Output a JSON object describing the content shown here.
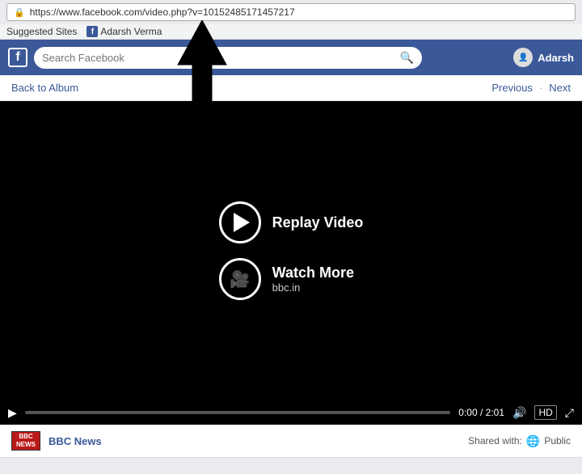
{
  "browser": {
    "url": "https://www.facebook.com/video.php?v=10152485171457217",
    "https_label": "https://www.facebook.com/video.php?v=10152485171457217",
    "bookmarks": [
      {
        "label": "Suggested Sites"
      },
      {
        "label": "Adarsh Verma",
        "has_fb_icon": true
      }
    ]
  },
  "navbar": {
    "logo_letter": "f",
    "search_placeholder": "Search Facebook",
    "user_name": "Adarsh"
  },
  "page_nav": {
    "back_label": "Back to Album",
    "previous_label": "Previous",
    "next_label": "Next"
  },
  "video": {
    "replay_label": "Replay Video",
    "watch_more_label": "Watch More",
    "watch_more_sub": "bbc.in",
    "time_current": "0:00",
    "time_total": "2:01",
    "quality_label": "HD",
    "play_icon": "▶",
    "pause_icon": "⏸",
    "volume_icon": "🔊",
    "fullscreen_icon": "⛶"
  },
  "video_info": {
    "source_name": "BBC News",
    "bbc_logo_text": "BBC\nNEWS",
    "shared_label": "Shared with:",
    "public_label": "Public"
  },
  "arrow": {
    "label": "arrow pointing up"
  }
}
